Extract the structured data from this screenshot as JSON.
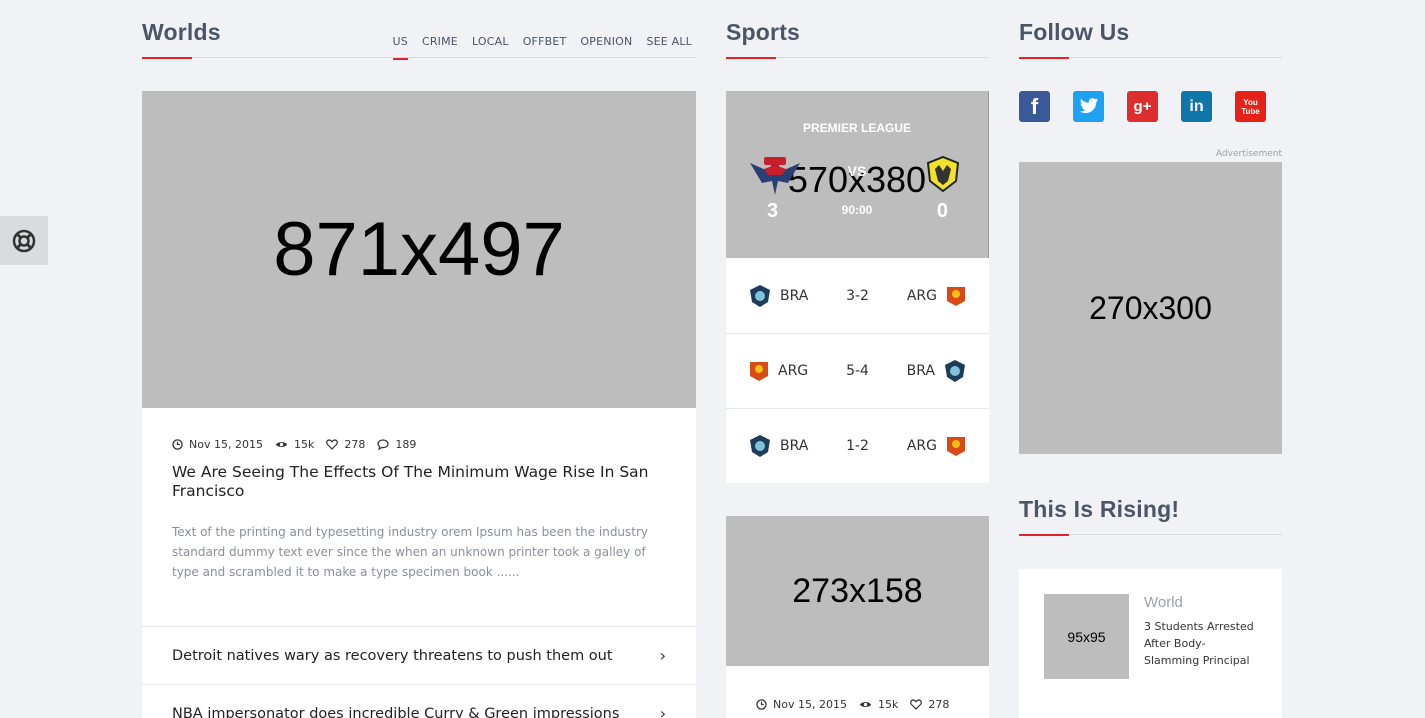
{
  "colors": {
    "accent": "#e8202a",
    "heading": "#4a5568",
    "placeholder": "#bdbdbd"
  },
  "worlds": {
    "title": "Worlds",
    "tabs": [
      "US",
      "CRIME",
      "LOCAL",
      "OFFBET",
      "OPENION",
      "SEE ALL"
    ],
    "active_tab": "US",
    "main": {
      "image": "871x497",
      "date": "Nov 15, 2015",
      "views": "15k",
      "likes": "278",
      "comments": "189",
      "title": "We Are Seeing The Effects Of The Minimum Wage Rise In San Francisco",
      "desc": "Text of the printing and typesetting industry orem Ipsum has been the industry standard dummy text ever since the when an unknown printer took a galley of type and scrambled it to make a type specimen book ......"
    },
    "list": [
      "Detroit natives wary as recovery threatens to push them out",
      "NBA impersonator does incredible Curry & Green impressions"
    ]
  },
  "sports": {
    "title": "Sports",
    "match": {
      "league": "PREMIER LEAGUE",
      "image": "570x380",
      "vs": "VS",
      "home_score": "3",
      "away_score": "0",
      "time": "90:00"
    },
    "results": [
      {
        "home": "BRA",
        "score": "3-2",
        "away": "ARG"
      },
      {
        "home": "ARG",
        "score": "5-4",
        "away": "BRA"
      },
      {
        "home": "BRA",
        "score": "1-2",
        "away": "ARG"
      }
    ],
    "card": {
      "image": "273x158",
      "date": "Nov 15, 2015",
      "views": "15k",
      "likes": "278"
    }
  },
  "follow": {
    "title": "Follow Us",
    "icons": [
      "facebook-icon",
      "twitter-icon",
      "google-plus-icon",
      "linkedin-icon",
      "youtube-icon"
    ],
    "advertisement_label": "Advertisement",
    "ad_image": "270x300"
  },
  "rising": {
    "title": "This Is Rising!",
    "item": {
      "image": "95x95",
      "category": "World",
      "title": "3 Students Arrested After Body-Slamming Principal"
    }
  }
}
